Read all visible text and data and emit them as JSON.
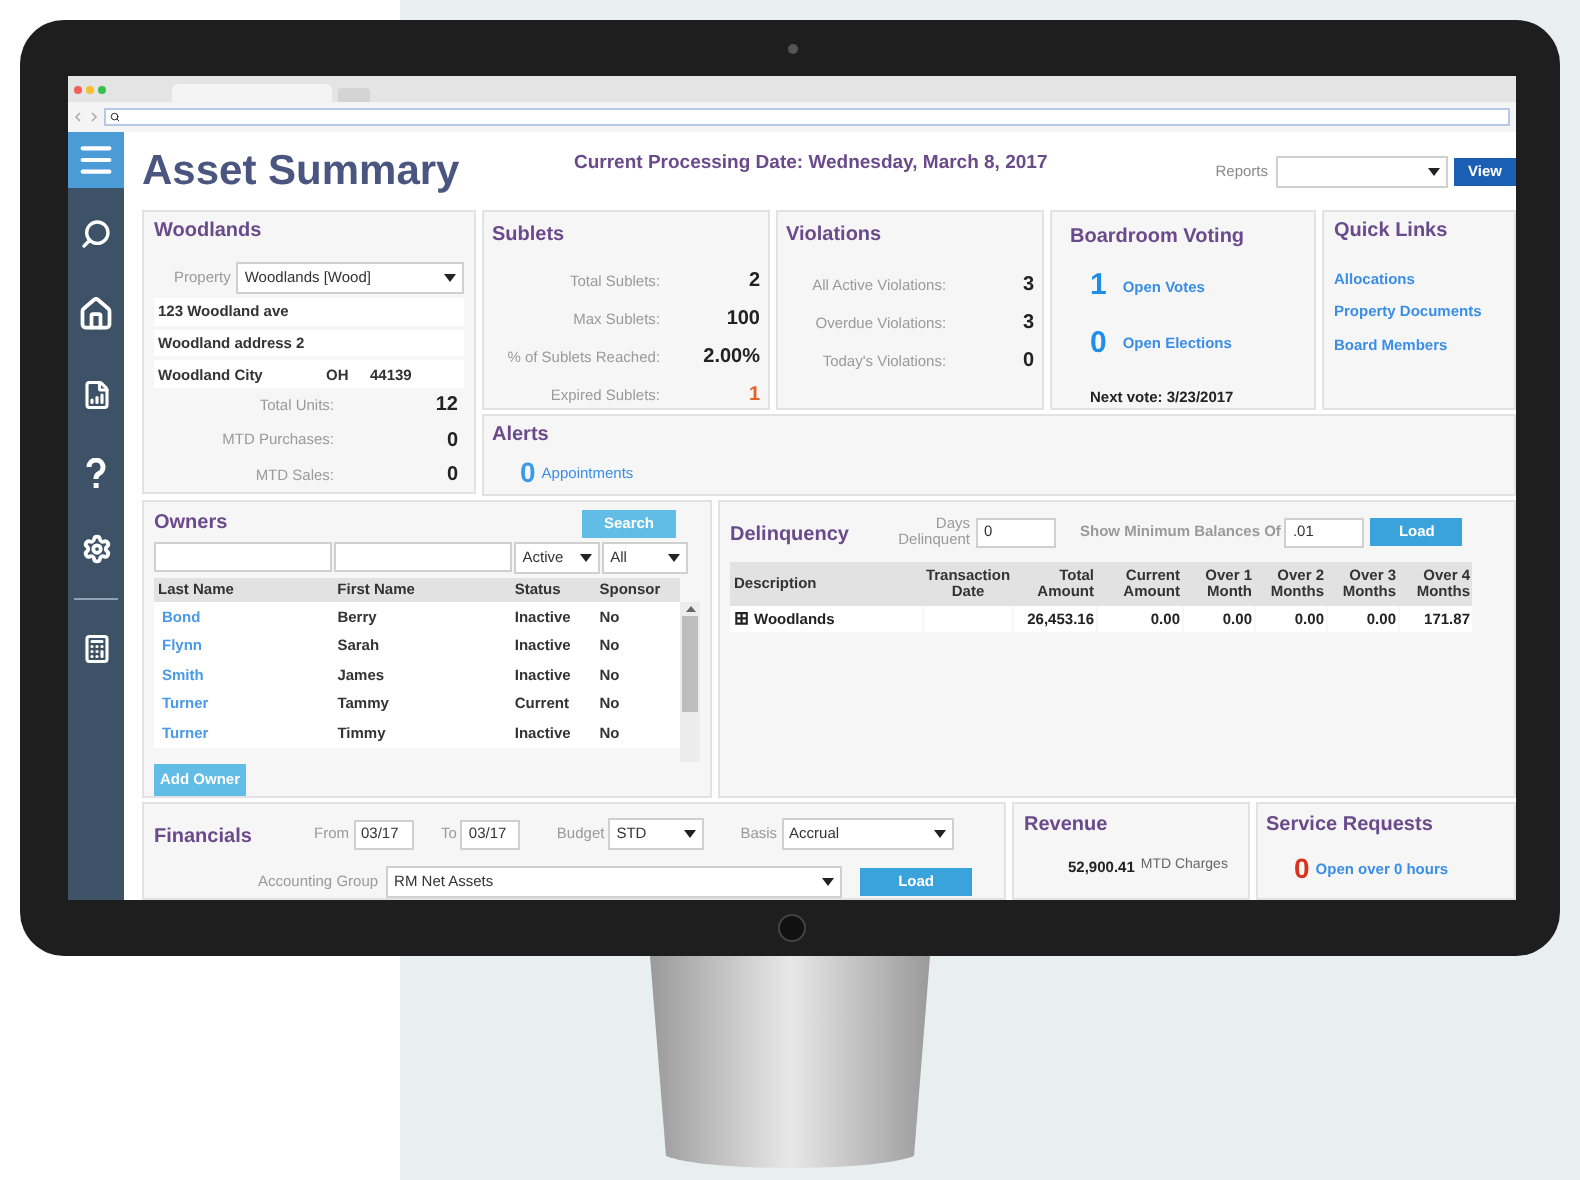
{
  "page": {
    "title": "Asset Summary",
    "processing_label": "Current Processing Date:",
    "processing_day": "Wednesday,",
    "processing_date": "March 8, 2017",
    "reports_label": "Reports",
    "view_button": "View"
  },
  "woodlands": {
    "title": "Woodlands",
    "property_label": "Property",
    "property_value": "Woodlands [Wood]",
    "address1": "123 Woodland ave",
    "address2": "Woodland address 2",
    "city": "Woodland City",
    "state": "OH",
    "zip": "44139",
    "stats": [
      {
        "label": "Total Units:",
        "value": "12"
      },
      {
        "label": "MTD Purchases:",
        "value": "0"
      },
      {
        "label": "MTD Sales:",
        "value": "0"
      }
    ]
  },
  "sublets": {
    "title": "Sublets",
    "stats": [
      {
        "label": "Total Sublets:",
        "value": "2",
        "alert": false
      },
      {
        "label": "Max Sublets:",
        "value": "100",
        "alert": false
      },
      {
        "label": "% of Sublets Reached:",
        "value": "2.00%",
        "alert": false
      },
      {
        "label": "Expired Sublets:",
        "value": "1",
        "alert": true
      }
    ]
  },
  "violations": {
    "title": "Violations",
    "stats": [
      {
        "label": "All Active Violations:",
        "value": "3"
      },
      {
        "label": "Overdue Violations:",
        "value": "3"
      },
      {
        "label": "Today's Violations:",
        "value": "0"
      }
    ]
  },
  "voting": {
    "title": "Boardroom Voting",
    "items": [
      {
        "count": "1",
        "label": "Open Votes"
      },
      {
        "count": "0",
        "label": "Open Elections"
      }
    ],
    "next_vote": "Next vote: 3/23/2017"
  },
  "quick_links": {
    "title": "Quick Links",
    "links": [
      "Allocations",
      "Property Documents",
      "Board Members"
    ]
  },
  "alerts": {
    "title": "Alerts",
    "count": "0",
    "label": "Appointments"
  },
  "owners": {
    "title": "Owners",
    "search_button": "Search",
    "status_filter": "Active",
    "sponsor_filter": "All",
    "columns": [
      "Last Name",
      "First Name",
      "Status",
      "Sponsor"
    ],
    "rows": [
      {
        "last": "Bond",
        "first": "Berry",
        "status": "Inactive",
        "sponsor": "No"
      },
      {
        "last": "Flynn",
        "first": "Sarah",
        "status": "Inactive",
        "sponsor": "No"
      },
      {
        "last": "Smith",
        "first": "James",
        "status": "Inactive",
        "sponsor": "No"
      },
      {
        "last": "Turner",
        "first": "Tammy",
        "status": "Current",
        "sponsor": "No"
      },
      {
        "last": "Turner",
        "first": "Timmy",
        "status": "Inactive",
        "sponsor": "No"
      }
    ],
    "add_button": "Add Owner"
  },
  "delinquency": {
    "title": "Delinquency",
    "days_label": "Days Delinquent",
    "days_value": "0",
    "min_label": "Show Minimum Balances Of",
    "min_value": ".01",
    "load_button": "Load",
    "columns": [
      "Description",
      "Transaction Date",
      "Total Amount",
      "Current Amount",
      "Over 1 Month",
      "Over 2 Months",
      "Over 3 Months",
      "Over 4 Months"
    ],
    "rows": [
      {
        "expand_glyph": "⊞",
        "cells": [
          "Woodlands",
          "",
          "26,453.16",
          "0.00",
          "0.00",
          "0.00",
          "0.00",
          "171.87"
        ]
      }
    ]
  },
  "financials": {
    "title": "Financials",
    "from_label": "From",
    "from_value": "03/17",
    "to_label": "To",
    "to_value": "03/17",
    "budget_label": "Budget",
    "budget_value": "STD",
    "basis_label": "Basis",
    "basis_value": "Accrual",
    "group_label": "Accounting Group",
    "group_value": "RM Net Assets",
    "load_button": "Load"
  },
  "revenue": {
    "title": "Revenue",
    "amount": "52,900.41",
    "label": "MTD Charges"
  },
  "service_requests": {
    "title": "Service Requests",
    "count": "0",
    "label": "Open over 0 hours"
  }
}
